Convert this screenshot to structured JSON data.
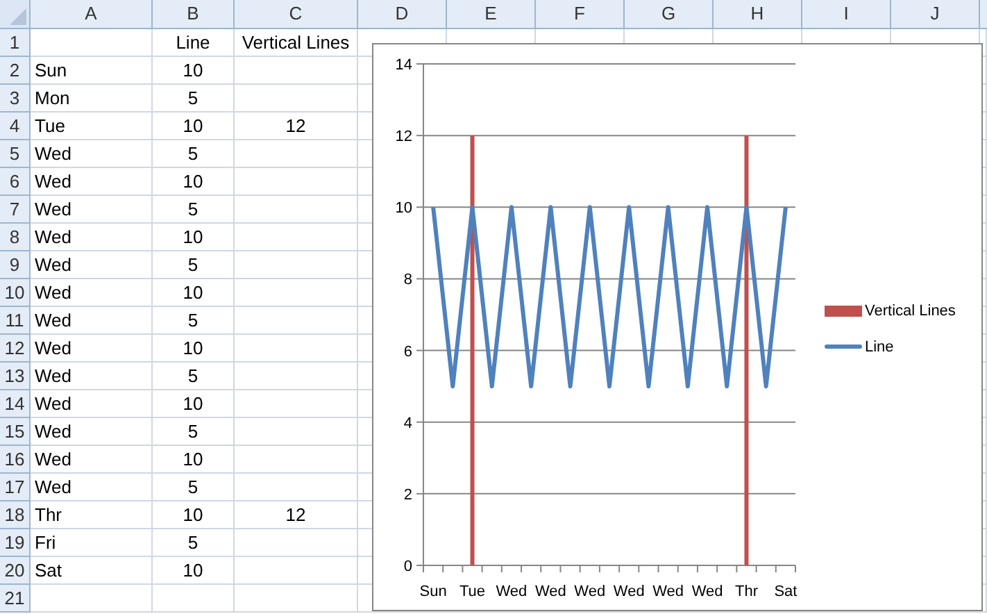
{
  "columns": [
    "A",
    "B",
    "C",
    "D",
    "E",
    "F",
    "G",
    "H",
    "I",
    "J"
  ],
  "rows": [
    {
      "number": "1",
      "b": "Line",
      "c": "Vertical Lines"
    },
    {
      "number": "2",
      "a": "Sun",
      "b": "10"
    },
    {
      "number": "3",
      "a": "Mon",
      "b": "5"
    },
    {
      "number": "4",
      "a": "Tue",
      "b": "10",
      "c": "12"
    },
    {
      "number": "5",
      "a": "Wed",
      "b": "5"
    },
    {
      "number": "6",
      "a": "Wed",
      "b": "10"
    },
    {
      "number": "7",
      "a": "Wed",
      "b": "5"
    },
    {
      "number": "8",
      "a": "Wed",
      "b": "10"
    },
    {
      "number": "9",
      "a": "Wed",
      "b": "5"
    },
    {
      "number": "10",
      "a": "Wed",
      "b": "10"
    },
    {
      "number": "11",
      "a": "Wed",
      "b": "5"
    },
    {
      "number": "12",
      "a": "Wed",
      "b": "10"
    },
    {
      "number": "13",
      "a": "Wed",
      "b": "5"
    },
    {
      "number": "14",
      "a": "Wed",
      "b": "10"
    },
    {
      "number": "15",
      "a": "Wed",
      "b": "5"
    },
    {
      "number": "16",
      "a": "Wed",
      "b": "10"
    },
    {
      "number": "17",
      "a": "Wed",
      "b": "5"
    },
    {
      "number": "18",
      "a": "Thr",
      "b": "10",
      "c": "12"
    },
    {
      "number": "19",
      "a": "Fri",
      "b": "5"
    },
    {
      "number": "20",
      "a": "Sat",
      "b": "10"
    },
    {
      "number": "21"
    }
  ],
  "chart": {
    "chart_data": {
      "type": "line",
      "categories": [
        "Sun",
        null,
        "Tue",
        null,
        "Wed",
        null,
        "Wed",
        null,
        "Wed",
        null,
        "Wed",
        null,
        "Wed",
        null,
        "Wed",
        null,
        "Thr",
        null,
        "Sat"
      ],
      "grid": true,
      "legend": true,
      "ylim": [
        0,
        14
      ],
      "yticks": [
        0,
        2,
        4,
        6,
        8,
        10,
        12,
        14
      ],
      "series": [
        {
          "name": "Vertical Lines",
          "type": "bar",
          "color": "#c0504d",
          "values": [
            null,
            null,
            12,
            null,
            null,
            null,
            null,
            null,
            null,
            null,
            null,
            null,
            null,
            null,
            null,
            null,
            12,
            null,
            null
          ]
        },
        {
          "name": "Line",
          "type": "line",
          "color": "#4f81bd",
          "values": [
            10,
            5,
            10,
            5,
            10,
            5,
            10,
            5,
            10,
            5,
            10,
            5,
            10,
            5,
            10,
            5,
            10,
            5,
            10
          ]
        }
      ]
    }
  }
}
